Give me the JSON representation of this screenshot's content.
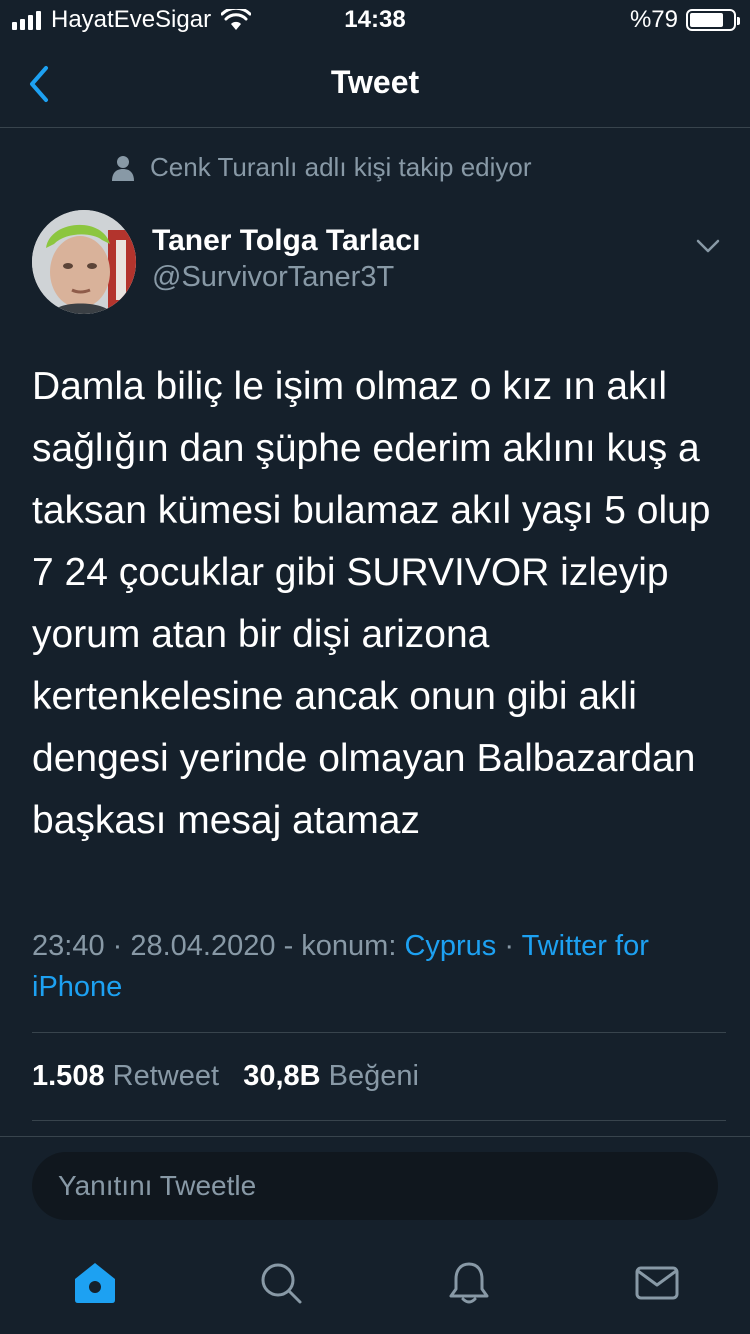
{
  "status_bar": {
    "carrier": "HayatEveSigar",
    "time": "14:38",
    "battery": "%79",
    "battery_level": 0.79
  },
  "nav": {
    "title": "Tweet",
    "back_icon": "chevron-left-icon"
  },
  "social_context": {
    "text": "Cenk Turanlı adlı kişi takip ediyor",
    "icon": "person-icon"
  },
  "author": {
    "name": "Taner Tolga Tarlacı",
    "handle": "@SurvivorTaner3T"
  },
  "tweet": {
    "text": "Damla biliç le işim olmaz o kız ın akıl sağlığın dan şüphe ederim aklını kuş a taksan kümesi bulamaz akıl yaşı 5 olup 7 24 çocuklar gibi SURVIVOR izleyip yorum atan bir dişi arizona kertenkelesine ancak onun gibi akli dengesi yerinde olmayan Balbazardan başkası mesaj atamaz",
    "time": "23:40",
    "sep1": " · ",
    "date": "28.04.2020",
    "location_prefix": " - konum: ",
    "location": "Cyprus",
    "sep2": " · ",
    "source": "Twitter for iPhone"
  },
  "stats": {
    "retweets": "1.508",
    "retweets_label": "Retweet",
    "likes": "30,8B",
    "likes_label": "Beğeni"
  },
  "reply": {
    "placeholder": "Yanıtını Tweetle"
  },
  "tabs": [
    {
      "icon": "home-icon",
      "active": true
    },
    {
      "icon": "search-icon",
      "active": false
    },
    {
      "icon": "bell-icon",
      "active": false
    },
    {
      "icon": "mail-icon",
      "active": false
    }
  ],
  "colors": {
    "background": "#15202b",
    "accent": "#1da1f2",
    "secondary_text": "#8899a6",
    "divider": "#38444d"
  }
}
